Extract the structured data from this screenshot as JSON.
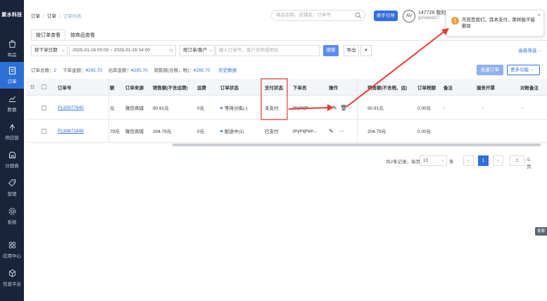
{
  "sidebar": {
    "logo": "聚水科技",
    "items": [
      {
        "label": "商品",
        "icon": "bag-icon"
      },
      {
        "label": "订单",
        "icon": "document-icon"
      },
      {
        "label": "数据",
        "icon": "chart-icon"
      },
      {
        "label": "供应链",
        "icon": "exchange-icon"
      },
      {
        "label": "分销商",
        "icon": "shop-icon"
      },
      {
        "label": "营销",
        "icon": "tag-icon"
      },
      {
        "label": "系统",
        "icon": "settings-icon"
      },
      {
        "label": "应用中心",
        "icon": "apps-icon"
      },
      {
        "label": "信息平台",
        "icon": "cube-icon"
      }
    ]
  },
  "header": {
    "breadcrumb": [
      "订单",
      "订单",
      "订单列表"
    ],
    "search_placeholder": "商品名称、店铺名、订单号",
    "new_button": "新手引导",
    "avatar": "AV",
    "user_id": "147726 我的",
    "user_sub": "gmstest27"
  },
  "tabs": [
    "按订单查看",
    "按商品查看"
  ],
  "filters": {
    "date_type": "按下单日期",
    "date_range": "2025-01-16 00:00 ~ 2025-01-16 24:00",
    "search_type": "按订单/客户",
    "search_placeholder": "输入订单号、客户名称或地址",
    "search_button": "搜索",
    "export_button": "导出",
    "advanced": "高级筛选"
  },
  "summary": {
    "count_label": "订单总数：",
    "count": "2",
    "amount_label": "下单金额：",
    "amount": "¥295.70",
    "out_label": "出库金额：",
    "out": "¥295.70",
    "sales_label": "销售额(含税，税)：",
    "sales": "¥295.70",
    "history_link": "历史数据",
    "batch_button": "批量订单",
    "more_button": "更多功能"
  },
  "table": {
    "columns": [
      "订单号",
      "额",
      "订单来源",
      "销售额(不含运费)",
      "运费",
      "订单状态",
      "支付状态",
      "下单员",
      "操作",
      "销售额(不含税、运)",
      "订单税额",
      "备注",
      "服务开票",
      "对账备注"
    ],
    "rows": [
      {
        "order_no": "PL90977645",
        "frag": "元",
        "source": "微信商城",
        "sales": "90.91元",
        "freight": "0元",
        "status": "等待分拣(-)",
        "pay": "未支付",
        "operator": "jinyingh...",
        "sales_ex": "90.91元",
        "tax": "0.00元",
        "remark": "-",
        "invoice": "-",
        "recon": "-"
      },
      {
        "order_no": "PL90871846",
        "frag": "79元",
        "source": "微信商城",
        "sales": "204.79元",
        "freight": "0元",
        "status": "配送中(1)",
        "pay": "已支付",
        "operator": "jinyinghan...",
        "sales_ex": "204.79元",
        "tax": "0.00元",
        "remark": "",
        "invoice": "",
        "recon": ""
      }
    ]
  },
  "pagination": {
    "total_text": "共2条记录，每页",
    "page_size": "10",
    "unit": "条",
    "current": "1",
    "jump_value": "1",
    "total_pages": "/1页"
  },
  "toast": {
    "text": "先就是我们，其本支付，那样能不能删除"
  },
  "side_tab": "客服",
  "colors": {
    "primary": "#2f6fde",
    "sidebar": "#18243a",
    "annotation_red": "#e53935"
  }
}
